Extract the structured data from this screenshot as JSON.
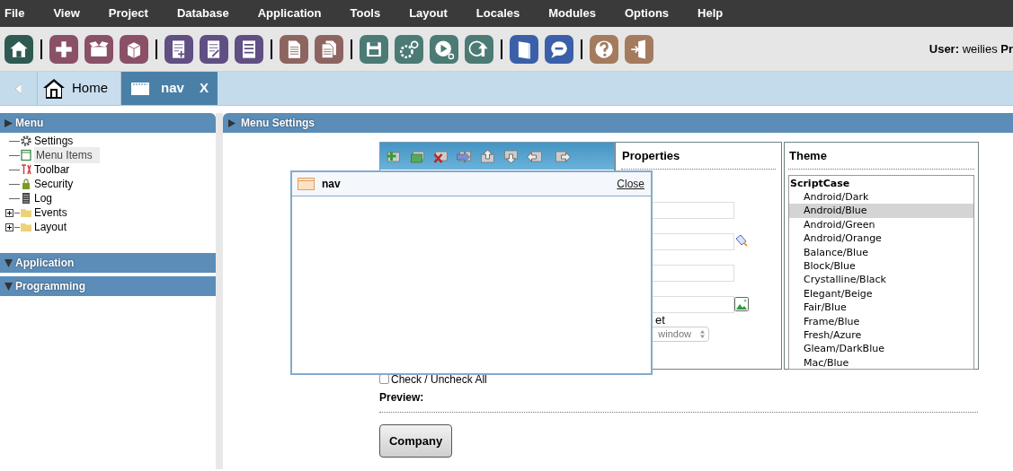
{
  "menubar": [
    "File",
    "View",
    "Project",
    "Database",
    "Application",
    "Tools",
    "Layout",
    "Locales",
    "Modules",
    "Options",
    "Help"
  ],
  "user": "**User:** weilies **Pr**",
  "tabs": [
    {
      "label": "Home",
      "kind": "home",
      "selected": false
    },
    {
      "label": "nav",
      "kind": "app",
      "selected": true,
      "close": "X"
    }
  ],
  "sidebar": [
    {
      "title": "Menu",
      "expanded": true,
      "items": [
        {
          "label": "Settings",
          "kind": "gear",
          "selected": false
        },
        {
          "label": "Menu Items",
          "kind": "window",
          "selected": true
        },
        {
          "label": "Toolbar",
          "kind": "tools",
          "selected": false
        },
        {
          "label": "Security",
          "kind": "lock",
          "selected": false
        },
        {
          "label": "Log",
          "kind": "list",
          "selected": false
        },
        {
          "label": "Events",
          "kind": "folder",
          "selected": false,
          "expanded": false
        },
        {
          "label": "Layout",
          "kind": "folder",
          "selected": false,
          "expanded": false
        }
      ]
    },
    {
      "title": "Application",
      "expanded": false
    },
    {
      "title": "Programming",
      "expanded": false
    }
  ],
  "content": {
    "title": "Menu Settings",
    "properties": {
      "title": "Properties",
      "target_label": "et",
      "target_select": "window"
    },
    "theme": {
      "title": "Theme",
      "groups": [
        {
          "label": "ScriptCase",
          "items": [
            {
              "label": "Android/Dark",
              "selected": false
            },
            {
              "label": "Android/Blue",
              "selected": true
            },
            {
              "label": "Android/Green",
              "selected": false
            },
            {
              "label": "Android/Orange",
              "selected": false
            },
            {
              "label": "Balance/Blue",
              "selected": false
            },
            {
              "label": "Block/Blue",
              "selected": false
            },
            {
              "label": "Crystalline/Black",
              "selected": false
            },
            {
              "label": "Elegant/Beige",
              "selected": false
            },
            {
              "label": "Fair/Blue",
              "selected": false
            },
            {
              "label": "Frame/Blue",
              "selected": false
            },
            {
              "label": "Fresh/Azure",
              "selected": false
            },
            {
              "label": "Gleam/DarkBlue",
              "selected": false
            },
            {
              "label": "Mac/Blue",
              "selected": false
            }
          ]
        }
      ]
    },
    "check_all": {
      "label": "Check / Uncheck All",
      "checked": false
    },
    "preview_label": "Preview:",
    "preview_button": "Company"
  },
  "dialog": {
    "title": "nav",
    "close": "Close"
  }
}
